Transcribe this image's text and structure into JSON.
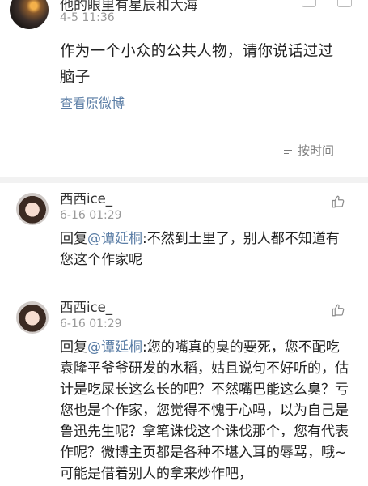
{
  "top_post": {
    "author": "他的眼里有星辰和大海",
    "time": "4-5 11:36",
    "text": "作为一个小众的公共人物，请你说话过过脑子",
    "view_original": "查看原微博",
    "sort_label": "按时间"
  },
  "comments": [
    {
      "author": "西西ice_",
      "time": "6-16 01:29",
      "reply_prefix": "回复",
      "mention": "@谭延桐",
      "text": ":不然到土里了，别人都不知道有您这个作家呢"
    },
    {
      "author": "西西ice_",
      "time": "6-16 01:29",
      "reply_prefix": "回复",
      "mention": "@谭延桐",
      "text": ":您的嘴真的臭的要死，您不配吃袁隆平爷爷研发的水稻，姑且说句不好听的，估计是吃屎长这么长的吧？不然嘴巴能这么臭？亏您也是个作家，您觉得不愧于心吗，以为自己是鲁迅先生呢？拿笔诛伐这个诛伐那个，您有代表作呢？微博主页都是各种不堪入耳的辱骂，哦~可能是借着别人的拿来炒作吧，"
    }
  ],
  "icons": {
    "like": "thumbs-up-icon",
    "sort": "sort-icon"
  }
}
